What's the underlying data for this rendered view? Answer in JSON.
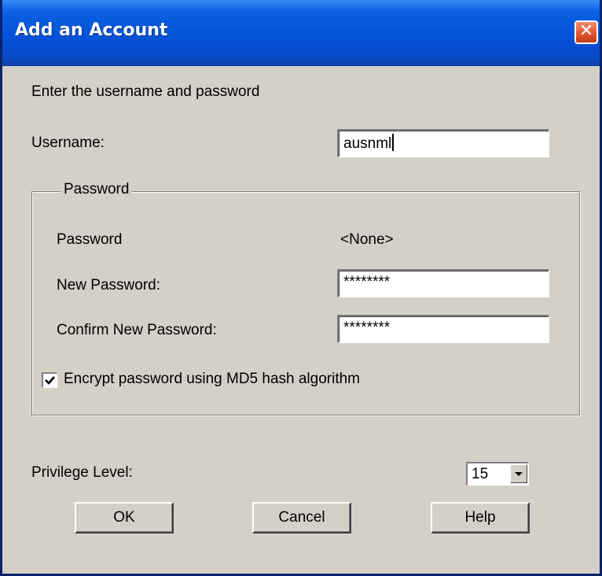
{
  "window": {
    "title": "Add an Account",
    "close_glyph": "✕"
  },
  "intro_text": "Enter the username and password",
  "username": {
    "label": "Username:",
    "value": "ausnml"
  },
  "password_group": {
    "legend": "Password",
    "current_label": "Password",
    "current_value": "<None>",
    "new_label": "New Password:",
    "new_value": "********",
    "confirm_label": "Confirm New Password:",
    "confirm_value": "********",
    "encrypt_label": "Encrypt password using MD5 hash algorithm",
    "encrypt_checked": true
  },
  "privilege": {
    "label": "Privilege Level:",
    "value": "15"
  },
  "buttons": {
    "ok": "OK",
    "cancel": "Cancel",
    "help": "Help"
  },
  "icons": {
    "close": "close-icon",
    "checkmark": "checkmark-icon",
    "dropdown": "chevron-down-icon"
  }
}
